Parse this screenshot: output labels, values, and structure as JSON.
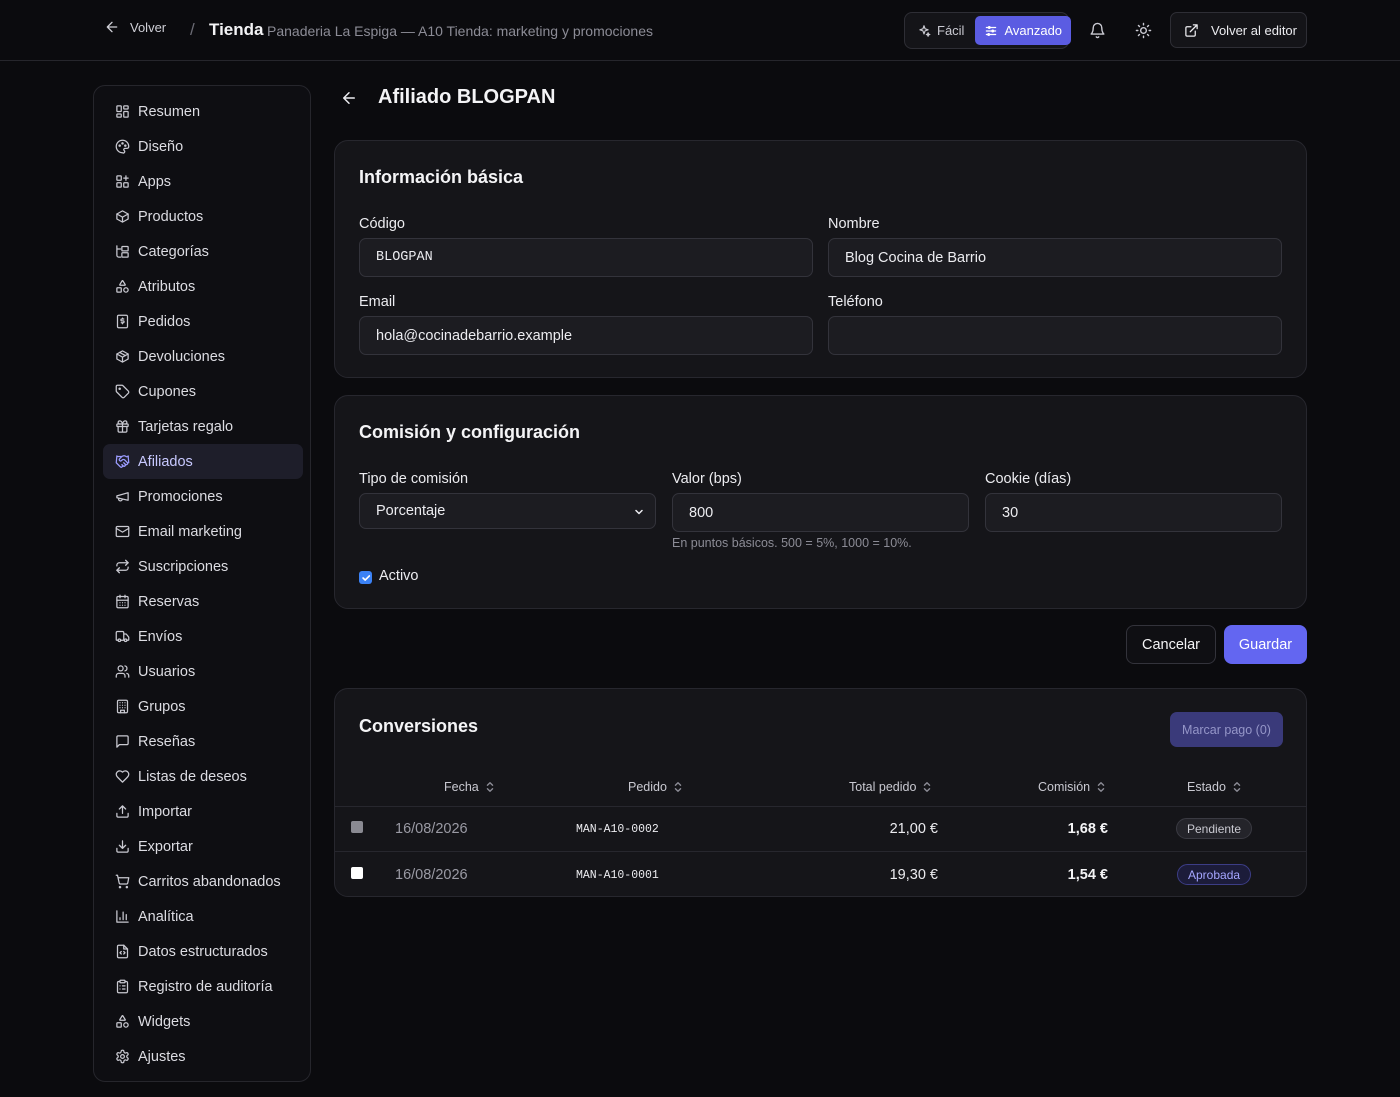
{
  "header": {
    "back_label": "Volver",
    "separator": "/",
    "section": "Tienda",
    "subtitle": "Panaderia La Espiga — A10 Tienda: marketing y promociones",
    "mode_easy": "Fácil",
    "mode_advanced": "Avanzado",
    "editor_button": "Volver al editor"
  },
  "sidebar": {
    "items": [
      {
        "label": "Resumen",
        "icon": "grid-icon"
      },
      {
        "label": "Diseño",
        "icon": "palette-icon"
      },
      {
        "label": "Apps",
        "icon": "apps-icon"
      },
      {
        "label": "Productos",
        "icon": "box-icon"
      },
      {
        "label": "Categorías",
        "icon": "tree-icon"
      },
      {
        "label": "Atributos",
        "icon": "shapes-icon"
      },
      {
        "label": "Pedidos",
        "icon": "receipt-icon"
      },
      {
        "label": "Devoluciones",
        "icon": "box-return-icon"
      },
      {
        "label": "Cupones",
        "icon": "tag-icon"
      },
      {
        "label": "Tarjetas regalo",
        "icon": "gift-icon"
      },
      {
        "label": "Afiliados",
        "icon": "handshake-icon",
        "active": true
      },
      {
        "label": "Promociones",
        "icon": "megaphone-icon"
      },
      {
        "label": "Email marketing",
        "icon": "mail-icon"
      },
      {
        "label": "Suscripciones",
        "icon": "repeat-icon"
      },
      {
        "label": "Reservas",
        "icon": "calendar-icon"
      },
      {
        "label": "Envíos",
        "icon": "truck-icon"
      },
      {
        "label": "Usuarios",
        "icon": "users-icon"
      },
      {
        "label": "Grupos",
        "icon": "building-icon"
      },
      {
        "label": "Reseñas",
        "icon": "message-icon"
      },
      {
        "label": "Listas de deseos",
        "icon": "heart-icon"
      },
      {
        "label": "Importar",
        "icon": "upload-icon"
      },
      {
        "label": "Exportar",
        "icon": "download-icon"
      },
      {
        "label": "Carritos abandonados",
        "icon": "cart-icon"
      },
      {
        "label": "Analítica",
        "icon": "chart-icon"
      },
      {
        "label": "Datos estructurados",
        "icon": "file-code-icon"
      },
      {
        "label": "Registro de auditoría",
        "icon": "clipboard-icon"
      },
      {
        "label": "Widgets",
        "icon": "widgets-icon"
      },
      {
        "label": "Ajustes",
        "icon": "gear-icon"
      }
    ]
  },
  "page": {
    "title": "Afiliado BLOGPAN"
  },
  "basic": {
    "title": "Información básica",
    "code_label": "Código",
    "code_value": "BLOGPAN",
    "name_label": "Nombre",
    "name_value": "Blog Cocina de Barrio",
    "email_label": "Email",
    "email_value": "hola@cocinadebarrio.example",
    "phone_label": "Teléfono",
    "phone_value": ""
  },
  "commission": {
    "title": "Comisión y configuración",
    "type_label": "Tipo de comisión",
    "type_value": "Porcentaje",
    "value_label": "Valor (bps)",
    "value_value": "800",
    "value_hint": "En puntos básicos. 500 = 5%, 1000 = 10%.",
    "cookie_label": "Cookie (días)",
    "cookie_value": "30",
    "active_label": "Activo",
    "active_checked": true
  },
  "actions": {
    "cancel": "Cancelar",
    "save": "Guardar"
  },
  "conversions": {
    "title": "Conversiones",
    "mark_paid": "Marcar pago (0)",
    "columns": [
      "Fecha",
      "Pedido",
      "Total pedido",
      "Comisión",
      "Estado"
    ],
    "rows": [
      {
        "date": "16/08/2026",
        "order": "MAN-A10-0002",
        "total": "21,00 €",
        "commission": "1,68 €",
        "status": "Pendiente",
        "selectable": false
      },
      {
        "date": "16/08/2026",
        "order": "MAN-A10-0001",
        "total": "19,30 €",
        "commission": "1,54 €",
        "status": "Aprobada",
        "selectable": true
      }
    ]
  },
  "colors": {
    "accent": "#6366f1",
    "background": "#0b0b0e",
    "card": "#151519"
  }
}
